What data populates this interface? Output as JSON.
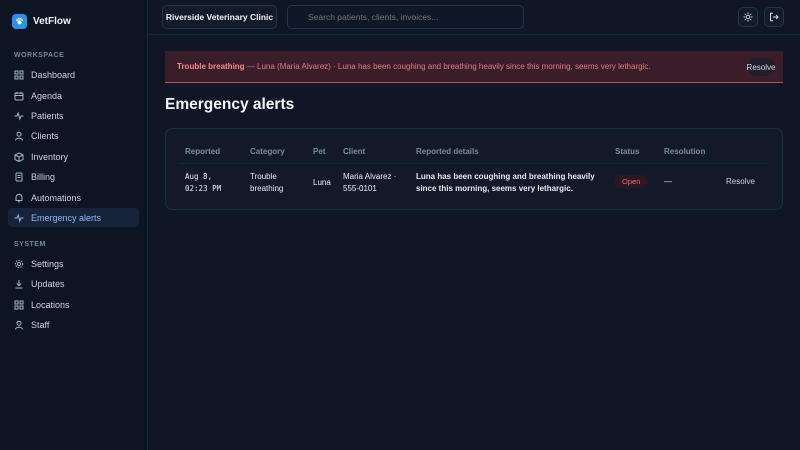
{
  "brand": {
    "name": "VetFlow"
  },
  "sidebar": {
    "workspace_label": "WORKSPACE",
    "system_label": "SYSTEM",
    "workspace_items": [
      {
        "label": "Dashboard",
        "icon": "grid-icon"
      },
      {
        "label": "Agenda",
        "icon": "calendar-icon"
      },
      {
        "label": "Patients",
        "icon": "pulse-icon"
      },
      {
        "label": "Clients",
        "icon": "user-icon"
      },
      {
        "label": "Inventory",
        "icon": "box-icon"
      },
      {
        "label": "Billing",
        "icon": "receipt-icon"
      },
      {
        "label": "Automations",
        "icon": "bell-icon"
      },
      {
        "label": "Emergency alerts",
        "icon": "pulse-icon",
        "active": true
      }
    ],
    "system_items": [
      {
        "label": "Settings",
        "icon": "gear-icon"
      },
      {
        "label": "Updates",
        "icon": "download-icon"
      },
      {
        "label": "Locations",
        "icon": "grid-icon"
      },
      {
        "label": "Staff",
        "icon": "user-icon"
      }
    ]
  },
  "topbar": {
    "clinic": "Riverside Veterinary Clinic",
    "search_placeholder": "Search patients, clients, invoices...",
    "theme_icon": "sun-icon",
    "logout_icon": "logout-icon"
  },
  "banner": {
    "title": "Trouble breathing",
    "message": " — Luna (Maria Alvarez) · Luna has been coughing and breathing heavily since this morning, seems very lethargic.",
    "resolve_label": "Resolve"
  },
  "page": {
    "title": "Emergency alerts"
  },
  "table": {
    "headers": {
      "reported": "Reported",
      "category": "Category",
      "pet": "Pet",
      "client": "Client",
      "details": "Reported details",
      "status": "Status",
      "resolution": "Resolution"
    },
    "rows": [
      {
        "reported_line1": "Aug 8,",
        "reported_line2": "02:23 PM",
        "category_line1": "Trouble",
        "category_line2": "breathing",
        "pet": "Luna",
        "client_line1": "Maria Alvarez ·",
        "client_line2": "555-0101",
        "details_line1": "Luna has been coughing and breathing heavily",
        "details_line2": "since this morning, seems very lethargic.",
        "status": "Open",
        "resolution": "—",
        "action": "Resolve"
      }
    ]
  },
  "colors": {
    "accent": "#8fb7f5",
    "danger": "#e36b70",
    "background": "#0f1726"
  }
}
